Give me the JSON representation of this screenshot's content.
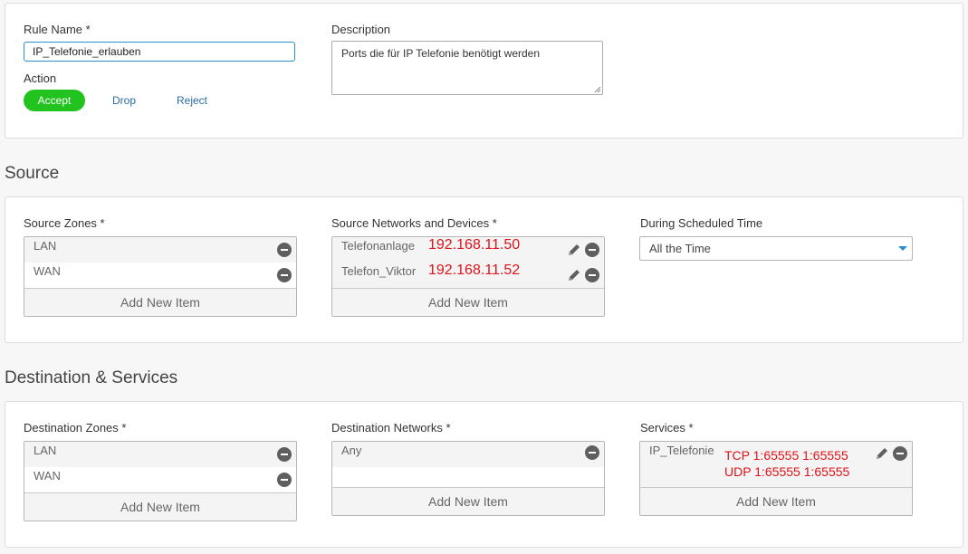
{
  "rule": {
    "name_label": "Rule Name *",
    "name_value": "IP_Telefonie_erlauben",
    "description_label": "Description",
    "description_value": "Ports die für IP Telefonie benötigt werden",
    "action_label": "Action",
    "actions": {
      "accept": "Accept",
      "drop": "Drop",
      "reject": "Reject"
    },
    "selected_action": "Accept"
  },
  "source": {
    "title": "Source",
    "zones_label": "Source Zones *",
    "zones": [
      "LAN",
      "WAN"
    ],
    "networks_label": "Source Networks and Devices *",
    "networks": [
      {
        "name": "Telefonanlage",
        "annotation": "192.168.11.50"
      },
      {
        "name": "Telefon_Viktor",
        "annotation": "192.168.11.52"
      }
    ],
    "schedule_label": "During Scheduled Time",
    "schedule_value": "All the Time"
  },
  "destination": {
    "title": "Destination & Services",
    "zones_label": "Destination Zones *",
    "zones": [
      "LAN",
      "WAN"
    ],
    "networks_label": "Destination Networks *",
    "networks": [
      "Any"
    ],
    "services_label": "Services *",
    "services": [
      {
        "name": "IP_Telefonie",
        "annotations": [
          "TCP 1:65555 1:65555",
          "UDP 1:65555 1:65555"
        ]
      }
    ]
  },
  "common": {
    "add_new_item": "Add New Item"
  },
  "colors": {
    "accent_green": "#22c31e",
    "link_blue": "#2b6ca8",
    "focus_blue": "#2a8bd0",
    "annotation_red": "#e0131a"
  },
  "icons": {
    "remove": "minus-circle-icon",
    "edit": "pencil-icon",
    "dropdown": "caret-down-icon"
  }
}
